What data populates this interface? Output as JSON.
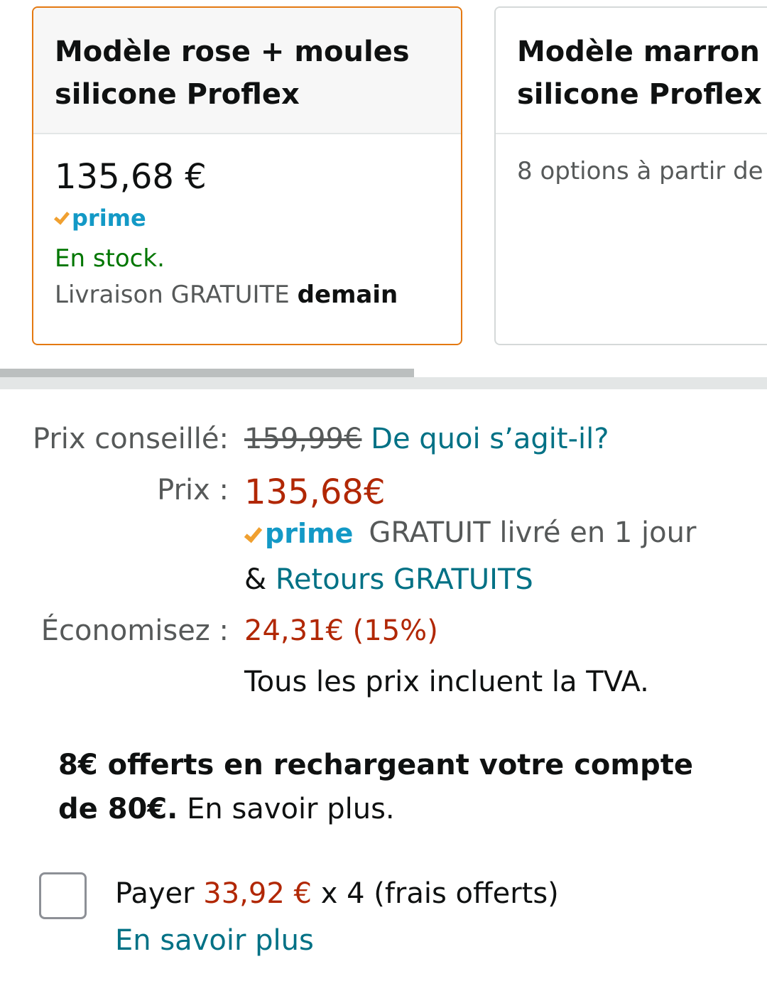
{
  "variants": [
    {
      "title_line1": "Modèle rose + moules",
      "title_line2": "silicone Proflex",
      "price": "135,68 €",
      "prime": "prime",
      "stock": "En stock.",
      "delivery_prefix": "Livraison GRATUITE",
      "delivery_day": "demain",
      "selected": true
    },
    {
      "title_line1": "Modèle marron +",
      "title_line2": "silicone Proflex",
      "options": "8 options à partir de",
      "selected": false
    }
  ],
  "pricing": {
    "list_label": "Prix conseillé:",
    "list_price": "159,99€",
    "what_is_it": "De quoi s’agit-il?",
    "price_label": "Prix :",
    "price": "135,68€",
    "prime": "prime",
    "prime_shipping": "GRATUIT livré en 1 jour",
    "returns_prefix": "&",
    "returns_link": "Retours GRATUITS",
    "savings_label": "Économisez :",
    "savings": "24,31€ (15%)",
    "vat_note": "Tous les prix incluent la TVA."
  },
  "promo": {
    "bold": "8€ offerts en rechargeant votre compte de 80€.",
    "link": "En savoir plus."
  },
  "installments": {
    "checked": false,
    "prefix": "Payer",
    "amount": "33,92 €",
    "suffix": "x 4 (frais offerts)",
    "link": "En savoir plus"
  },
  "colors": {
    "accent_orange": "#e47911",
    "price_red": "#b12704",
    "link_teal": "#007185",
    "stock_green": "#007600",
    "prime_blue": "#1399c6"
  }
}
